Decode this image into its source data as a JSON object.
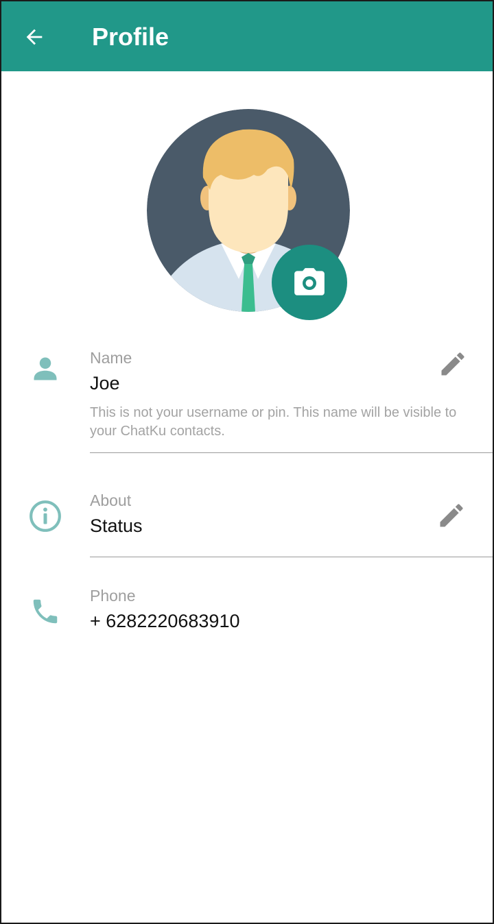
{
  "appbar": {
    "title": "Profile",
    "back_icon": "arrow-left-icon",
    "color": "#219889"
  },
  "avatar": {
    "icon": "user-avatar-illustration",
    "camera_icon": "camera-icon",
    "camera_color": "#1c8e80"
  },
  "name_section": {
    "icon": "person-icon",
    "label": "Name",
    "value": "Joe",
    "hint": "This is not your username or pin. This name will be visible to your ChatKu contacts.",
    "edit_icon": "pencil-icon"
  },
  "about_section": {
    "icon": "info-icon",
    "label": "About",
    "value": "Status",
    "edit_icon": "pencil-icon"
  },
  "phone_section": {
    "icon": "phone-icon",
    "label": "Phone",
    "value": "+ 6282220683910"
  },
  "colors": {
    "icon_teal": "#7fbfbb",
    "edit_gray": "#8a8a8a"
  }
}
